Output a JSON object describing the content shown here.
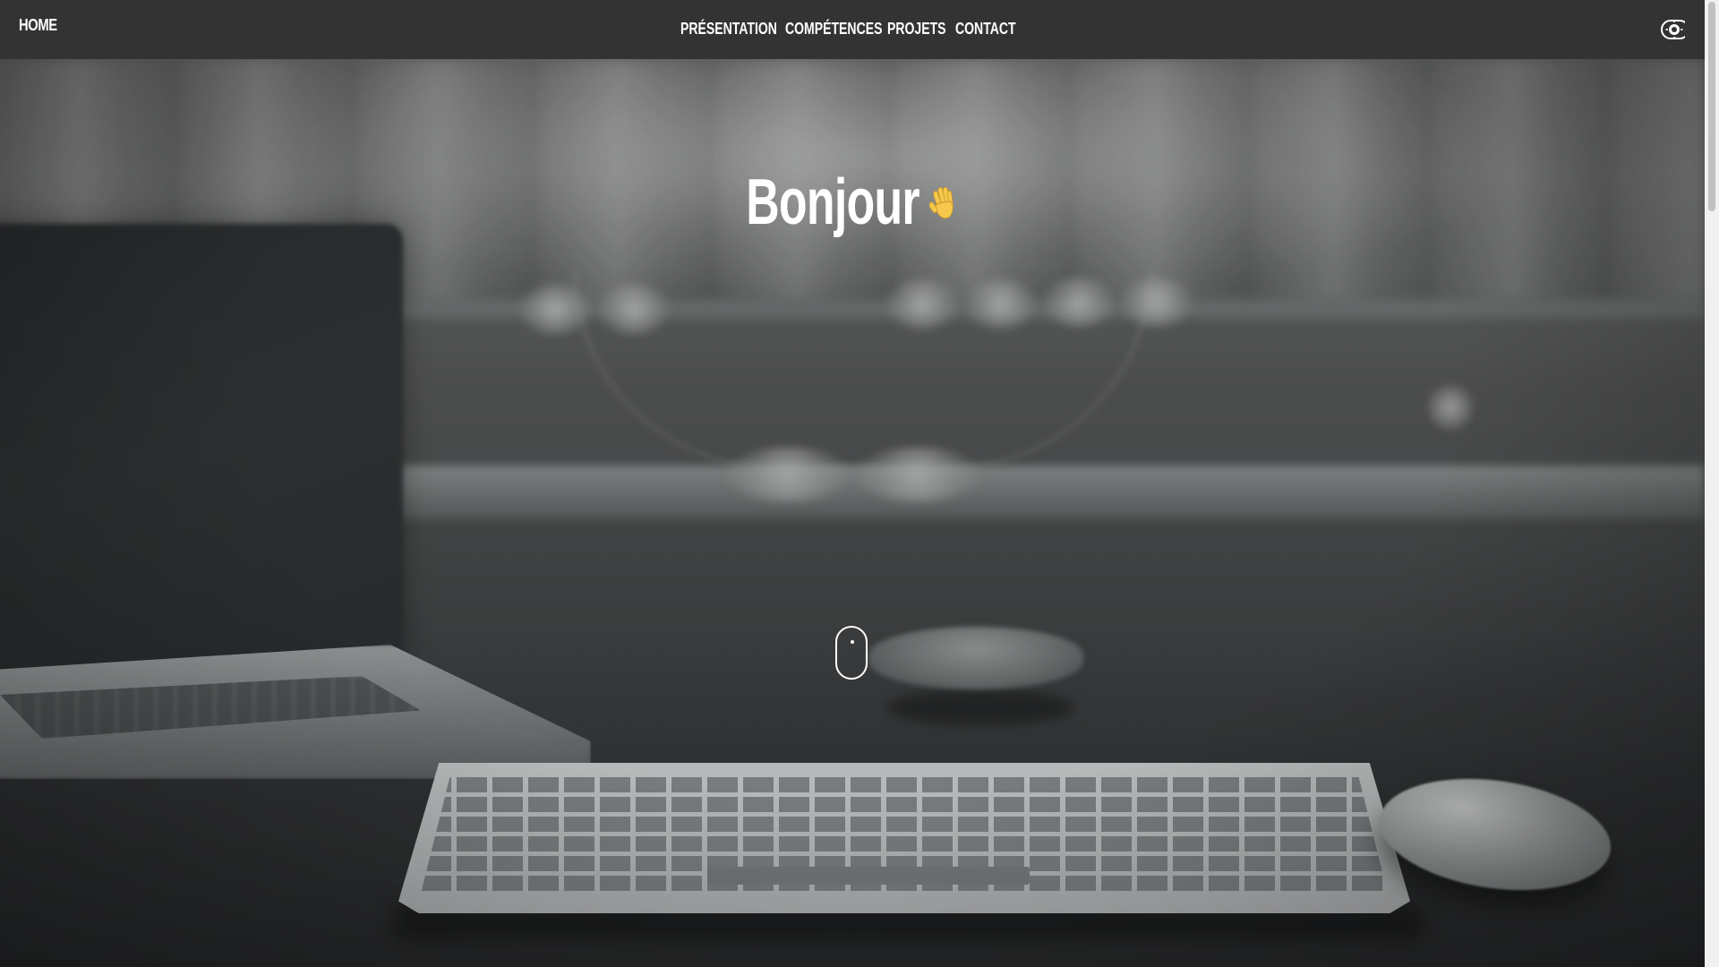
{
  "navbar": {
    "home_label": "HOME",
    "links": [
      {
        "label": "PRÉSENTATION"
      },
      {
        "label": "COMPÉTENCES"
      },
      {
        "label": "PROJETS"
      },
      {
        "label": "CONTACT"
      }
    ],
    "theme_toggle_icon": "theme-toggle-icon"
  },
  "hero": {
    "title": "Bonjour",
    "emoji_icon": "waving-hand-icon",
    "scroll_indicator_icon": "mouse-scroll-icon"
  },
  "colors": {
    "navbar_bg": "#333333",
    "nav_text": "#ffffff",
    "hero_text": "#ffffff",
    "emoji": "#f5c84c"
  }
}
